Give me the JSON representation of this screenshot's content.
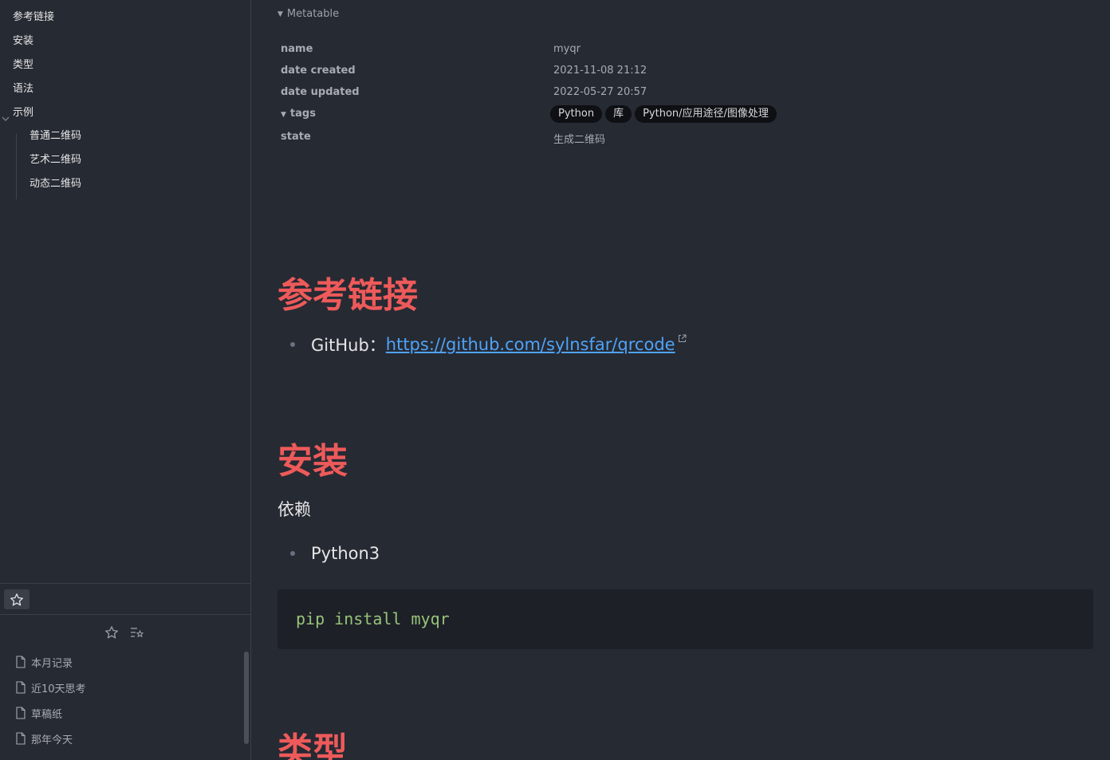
{
  "outline": {
    "items": [
      {
        "label": "参考链接"
      },
      {
        "label": "安装"
      },
      {
        "label": "类型"
      },
      {
        "label": "语法"
      },
      {
        "label": "示例",
        "expanded": true
      }
    ],
    "children": [
      {
        "label": "普通二维码"
      },
      {
        "label": "艺术二维码"
      },
      {
        "label": "动态二维码"
      }
    ]
  },
  "favorites": {
    "tab_icon": "star-icon",
    "action_icons": [
      "star-icon",
      "sort-favorites-icon"
    ],
    "items": [
      {
        "label": "本月记录",
        "icon": "file-icon"
      },
      {
        "label": "近10天思考",
        "icon": "file-icon"
      },
      {
        "label": "草稿纸",
        "icon": "file-icon"
      },
      {
        "label": "那年今天",
        "icon": "file-icon"
      }
    ]
  },
  "metatable": {
    "title": "Metatable",
    "rows": [
      {
        "key": "name",
        "value": "myqr"
      },
      {
        "key": "date created",
        "value": "2021-11-08 21:12"
      },
      {
        "key": "date updated",
        "value": "2022-05-27 20:57"
      },
      {
        "key": "tags",
        "value": ""
      },
      {
        "key": "state",
        "value": "生成二维码"
      }
    ],
    "tags": [
      "Python",
      "库",
      "Python/应用途径/图像处理"
    ]
  },
  "content": {
    "h_links": "参考链接",
    "github_label": "GitHub：",
    "github_url": "https://github.com/sylnsfar/qrcode",
    "h_install": "安装",
    "deps_label": "依赖",
    "dep_item": "Python3",
    "code": "pip install myqr",
    "h_types": "类型"
  },
  "colors": {
    "background": "#262a33",
    "heading": "#ee5a5a",
    "link": "#4fa3f7",
    "code": "#98c379"
  }
}
